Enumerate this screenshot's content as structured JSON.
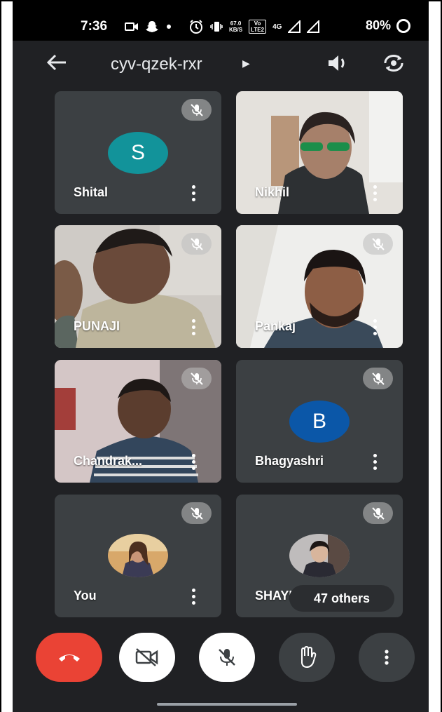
{
  "status_bar": {
    "time": "7:36",
    "speed_value": "67.0",
    "speed_unit": "KB/S",
    "volte_top": "Vo",
    "volte_bottom": "LTE2",
    "network": "4G",
    "battery": "80%"
  },
  "header": {
    "meeting_code": "cyv-qzek-rxr",
    "back_icon": "arrow-left-icon",
    "speaker_icon": "speaker-icon",
    "switch_camera_icon": "switch-camera-icon"
  },
  "participants": [
    {
      "name": "Shital",
      "initial": "S",
      "avatar_color": "#12939a",
      "muted": true
    },
    {
      "name": "Nikhil",
      "muted": false
    },
    {
      "name": "PUNAJI",
      "muted": true
    },
    {
      "name": "Pankaj",
      "muted": true
    },
    {
      "name": "Chandrak...",
      "muted": true
    },
    {
      "name": "Bhagyashri",
      "initial": "B",
      "avatar_color": "#0b57a8",
      "muted": true
    },
    {
      "name": "You",
      "muted": true
    },
    {
      "name": "SHAYI",
      "muted": true
    }
  ],
  "others_badge": "47 others",
  "controls": {
    "end_call_color": "#ea4335",
    "items": [
      "end-call",
      "camera-off",
      "mic-off",
      "raise-hand",
      "more-options"
    ]
  }
}
